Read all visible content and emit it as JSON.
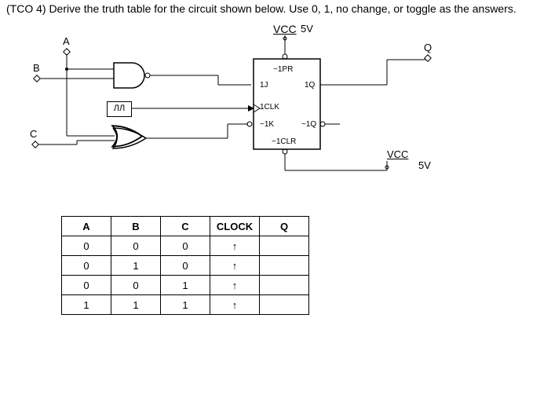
{
  "question": "(TCO 4) Derive the truth table for the circuit shown below. Use 0, 1, no change, or toggle as the answers.",
  "circuit": {
    "vcc_top": "VCC",
    "five_v_right": "5V",
    "vcc_bottom": "VCC",
    "five_v_bottom": "5V",
    "inputs": {
      "a": "A",
      "b": "B",
      "c": "C"
    },
    "output": "Q",
    "ff_pins": {
      "pr": "~1PR",
      "j": "1J",
      "clk": "1CLK",
      "k": "~1K",
      "clr": "~1CLR",
      "q": "1Q",
      "qn": "~1Q"
    }
  },
  "table": {
    "headers": [
      "A",
      "B",
      "C",
      "CLOCK",
      "Q"
    ],
    "rows": [
      [
        "0",
        "0",
        "0",
        "↑",
        ""
      ],
      [
        "0",
        "1",
        "0",
        "↑",
        ""
      ],
      [
        "0",
        "0",
        "1",
        "↑",
        ""
      ],
      [
        "1",
        "1",
        "1",
        "↑",
        ""
      ]
    ]
  }
}
